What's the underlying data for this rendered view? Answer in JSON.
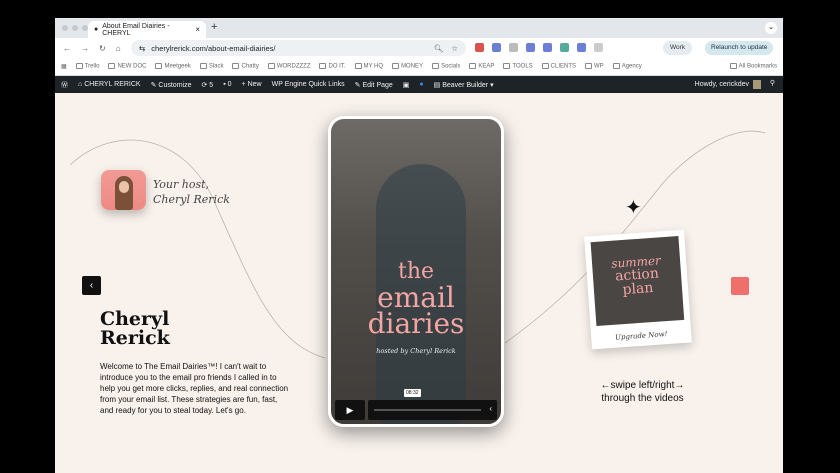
{
  "browser": {
    "tab_title": "About Email Diairies - CHERYL",
    "url": "cherylrerick.com/about-email-diairies/",
    "profile": "Work",
    "relaunch": "Relaunch to update"
  },
  "bookmarks": [
    "Trello",
    "NEW DOC",
    "Meetgeek",
    "Slack",
    "Chatty",
    "WORDZZZZ",
    "DO IT.",
    "MY HQ",
    "MONEY",
    "Socials",
    "KEAP",
    "TOOLS",
    "CLIENTS",
    "WP",
    "Agency"
  ],
  "all_bookmarks": "All Bookmarks",
  "wpbar": {
    "site": "CHERYL RERICK",
    "customize": "Customize",
    "updates": "5",
    "comments": "0",
    "new": "New",
    "wpengine": "WP Engine Quick Links",
    "edit": "Edit Page",
    "beaver": "Beaver Builder",
    "howdy": "Howdy, cerickdev"
  },
  "host": {
    "label_line1": "Your host,",
    "label_line2": "Cheryl Rerick",
    "name_line1": "Cheryl",
    "name_line2": "Rerick",
    "intro": "Welcome to The Email Dairies™! I can't wait to introduce you to the email pro friends I called in to help you get more clicks, replies, and real connection from your email list. These strategies are fun, fast, and ready for you to steal today. Let's go."
  },
  "video": {
    "title_line1": "the",
    "title_line2": "email",
    "title_line3": "diaries",
    "hosted": "hosted by Cheryl Rerick",
    "time": "08:32",
    "progress": 0
  },
  "promo": {
    "line1": "summer",
    "line2": "action",
    "line3": "plan",
    "cta": "Upgrade Now!"
  },
  "swipe": {
    "line1": "←swipe left/right→",
    "line2": "through the videos"
  },
  "colors": {
    "accent": "#ef6f6c",
    "background": "#f8f1ec",
    "title_pink": "#f4a5a3"
  }
}
